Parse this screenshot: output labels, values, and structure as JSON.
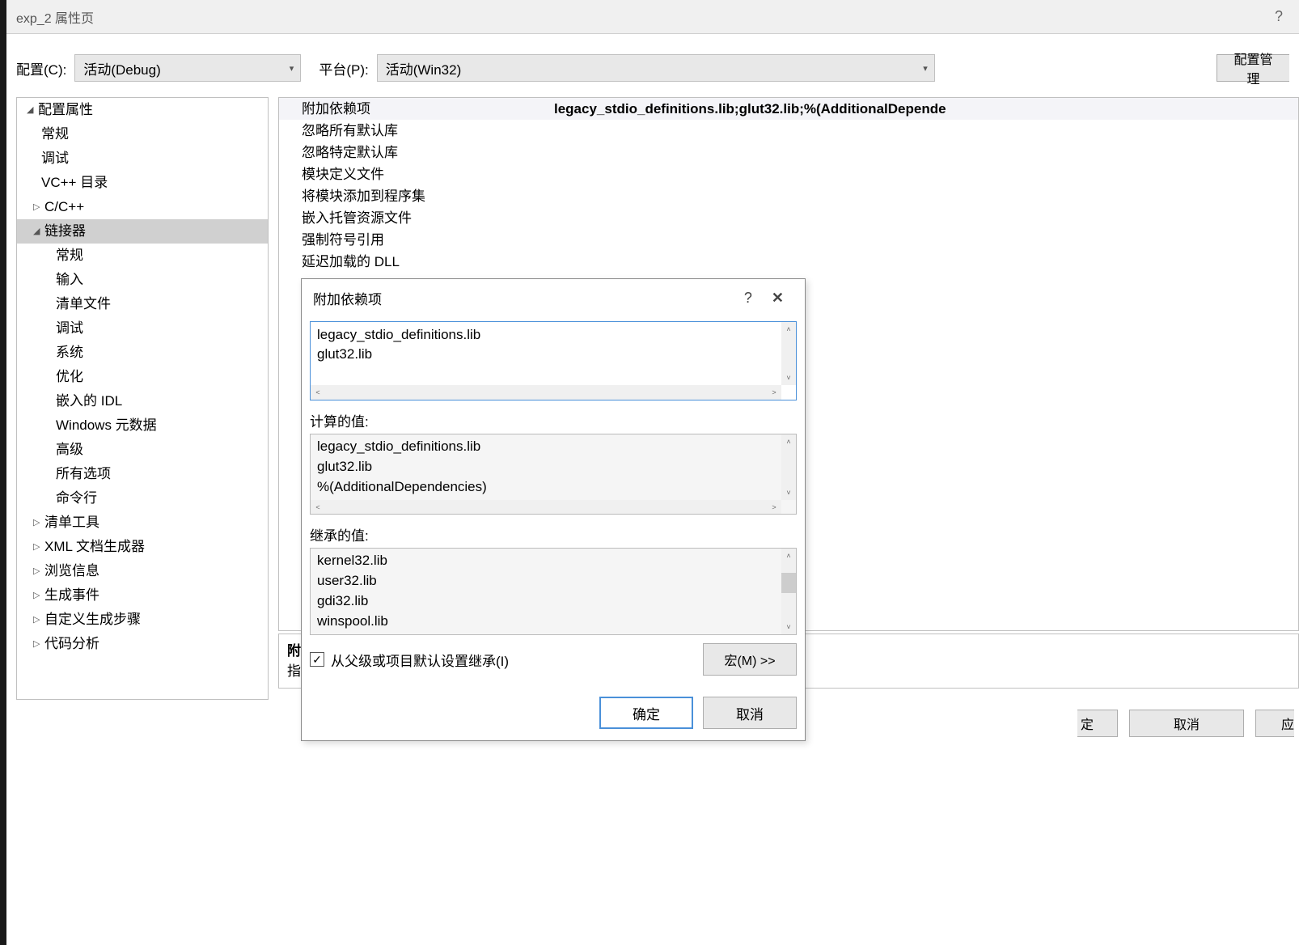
{
  "window": {
    "title": "exp_2 属性页"
  },
  "toolbar": {
    "config_label": "配置(C):",
    "config_value": "活动(Debug)",
    "platform_label": "平台(P):",
    "platform_value": "活动(Win32)",
    "config_manager": "配置管理"
  },
  "tree": {
    "root": "配置属性",
    "items_l1": [
      "常规",
      "调试",
      "VC++ 目录"
    ],
    "cpp": "C/C++",
    "linker": "链接器",
    "linker_children": [
      "常规",
      "输入",
      "清单文件",
      "调试",
      "系统",
      "优化",
      "嵌入的 IDL",
      "Windows 元数据",
      "高级",
      "所有选项",
      "命令行"
    ],
    "rest": [
      "清单工具",
      "XML 文档生成器",
      "浏览信息",
      "生成事件",
      "自定义生成步骤",
      "代码分析"
    ]
  },
  "props": {
    "rows": [
      {
        "label": "附加依赖项",
        "value": "legacy_stdio_definitions.lib;glut32.lib;%(AdditionalDepende"
      },
      {
        "label": "忽略所有默认库",
        "value": ""
      },
      {
        "label": "忽略特定默认库",
        "value": ""
      },
      {
        "label": "模块定义文件",
        "value": ""
      },
      {
        "label": "将模块添加到程序集",
        "value": ""
      },
      {
        "label": "嵌入托管资源文件",
        "value": ""
      },
      {
        "label": "强制符号引用",
        "value": ""
      },
      {
        "label": "延迟加载的 DLL",
        "value": ""
      }
    ]
  },
  "desc": {
    "title": "附",
    "body": "指"
  },
  "buttons": {
    "ok_partial": "定",
    "cancel": "取消",
    "apply": "应"
  },
  "dialog": {
    "title": "附加依赖项",
    "edit_lines": [
      "legacy_stdio_definitions.lib",
      "glut32.lib"
    ],
    "computed_label": "计算的值:",
    "computed_lines": [
      "legacy_stdio_definitions.lib",
      "glut32.lib",
      "%(AdditionalDependencies)"
    ],
    "inherited_label": "继承的值:",
    "inherited_lines": [
      "kernel32.lib",
      "user32.lib",
      "gdi32.lib",
      "winspool.lib"
    ],
    "inherit_checkbox": "从父级或项目默认设置继承(I)",
    "macros": "宏(M) >>",
    "ok": "确定",
    "cancel": "取消"
  }
}
